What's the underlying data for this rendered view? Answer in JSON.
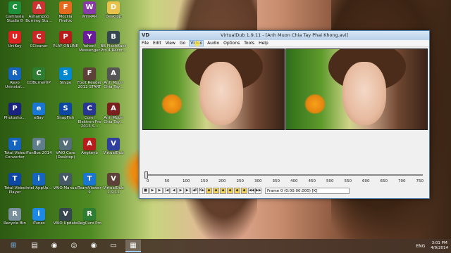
{
  "desktop_icons": [
    {
      "label": "Camtasia Studio 8",
      "glyph": "C",
      "color": "#1e8f3a"
    },
    {
      "label": "Ashampoo Burning Stu...",
      "glyph": "A",
      "color": "#c33"
    },
    {
      "label": "Mozilla Firefox",
      "glyph": "F",
      "color": "#e66a1d"
    },
    {
      "label": "WinRAR",
      "glyph": "W",
      "color": "#8a3aa8"
    },
    {
      "label": "Desktop",
      "glyph": "D",
      "color": "#e8c24a"
    },
    {
      "label": "UniKey",
      "glyph": "U",
      "color": "#d22"
    },
    {
      "label": "CCleaner",
      "glyph": "C",
      "color": "#c62828"
    },
    {
      "label": "PLAY ONLINE",
      "glyph": "P",
      "color": "#b71c1c"
    },
    {
      "label": "Yahoo! Messenger",
      "glyph": "Y",
      "color": "#6a1b9a"
    },
    {
      "label": "BB FlashBack Pro 4 Recor...",
      "glyph": "B",
      "color": "#37474f"
    },
    {
      "label": "Revo Uninstal...",
      "glyph": "R",
      "color": "#1565c0"
    },
    {
      "label": "CDBurnerXP",
      "glyph": "C",
      "color": "#2e7d32"
    },
    {
      "label": "Skype",
      "glyph": "S",
      "color": "#0288d1"
    },
    {
      "label": "Foxit Reader 2012 START",
      "glyph": "F",
      "color": "#5d4037"
    },
    {
      "label": "Anh Muon Chia Tay...",
      "glyph": "A",
      "color": "#555"
    },
    {
      "label": "Photosho...",
      "glyph": "P",
      "color": "#1a237e"
    },
    {
      "label": "eBay",
      "glyph": "e",
      "color": "#1976d2"
    },
    {
      "label": "SnapFish",
      "glyph": "S",
      "color": "#0d47a1"
    },
    {
      "label": "Corel Elektron Pro 2013 S...",
      "glyph": "C",
      "color": "#283593"
    },
    {
      "label": "Anh Muon Chia Tay...",
      "glyph": "A",
      "color": "#7b1f1f"
    },
    {
      "label": "Total Video Converter",
      "glyph": "T",
      "color": "#1565c0"
    },
    {
      "label": "iFunBox 2014",
      "glyph": "F",
      "color": "#607d8b"
    },
    {
      "label": "VAIO Care (Desktop)",
      "glyph": "V",
      "color": "#546e7a"
    },
    {
      "label": "Angkeyb",
      "glyph": "A",
      "color": "#b71c1c"
    },
    {
      "label": "VirtualDub",
      "glyph": "V",
      "color": "#303f9f"
    },
    {
      "label": "Total Video Player",
      "glyph": "T",
      "color": "#0d47a1"
    },
    {
      "label": "Intel AppUp...",
      "glyph": "i",
      "color": "#1565c0"
    },
    {
      "label": "VAIO Manual",
      "glyph": "V",
      "color": "#455a64"
    },
    {
      "label": "TeamViewer 9",
      "glyph": "T",
      "color": "#1976d2"
    },
    {
      "label": "VirtualDub 1.9.11",
      "glyph": "V",
      "color": "#5d4037"
    },
    {
      "label": "Recycle Bin",
      "glyph": "R",
      "color": "#78909c"
    },
    {
      "label": "iTunes",
      "glyph": "i",
      "color": "#1e88e5"
    },
    {
      "label": "VAIO Update",
      "glyph": "V",
      "color": "#37474f"
    },
    {
      "label": "RegCure Pro",
      "glyph": "R",
      "color": "#2e7d32"
    }
  ],
  "window": {
    "title": "VirtualDub 1.9.11 - [Anh Muon Chia Tay Phai Khong.avi]",
    "app_icon": "VD",
    "menu": [
      "File",
      "Edit",
      "View",
      "Go",
      "Video",
      "Audio",
      "Options",
      "Tools",
      "Help"
    ],
    "hovered_menu": "Video",
    "ticks": [
      "0",
      "50",
      "100",
      "150",
      "200",
      "250",
      "300",
      "350",
      "400",
      "450",
      "500",
      "550",
      "600",
      "650",
      "700",
      "750"
    ],
    "frame_readout": "Frame 0 (0:00:00.000) [K]",
    "toolbar_glyphs": [
      "■",
      "▶",
      "▶",
      "|◀",
      "◀",
      "▶",
      "▶|",
      "◀K",
      "K▶",
      "◆",
      "◆",
      "◆",
      "◆",
      "◆",
      "◆",
      "◀◀",
      "▶▶"
    ]
  },
  "taskbar": {
    "start_glyph": "⊞",
    "apps": [
      {
        "glyph": "▤",
        "name": "office"
      },
      {
        "glyph": "◉",
        "name": "chrome"
      },
      {
        "glyph": "◎",
        "name": "daemon"
      },
      {
        "glyph": "◉",
        "name": "firefox"
      },
      {
        "glyph": "▭",
        "name": "explorer"
      },
      {
        "glyph": "▦",
        "name": "virtualdub"
      }
    ],
    "tray": {
      "lang": "ENG",
      "time": "3:01 PM",
      "date": "4/9/2014"
    }
  },
  "colors": {
    "accent": "#4a7aa8",
    "taskbar": "#463428"
  }
}
